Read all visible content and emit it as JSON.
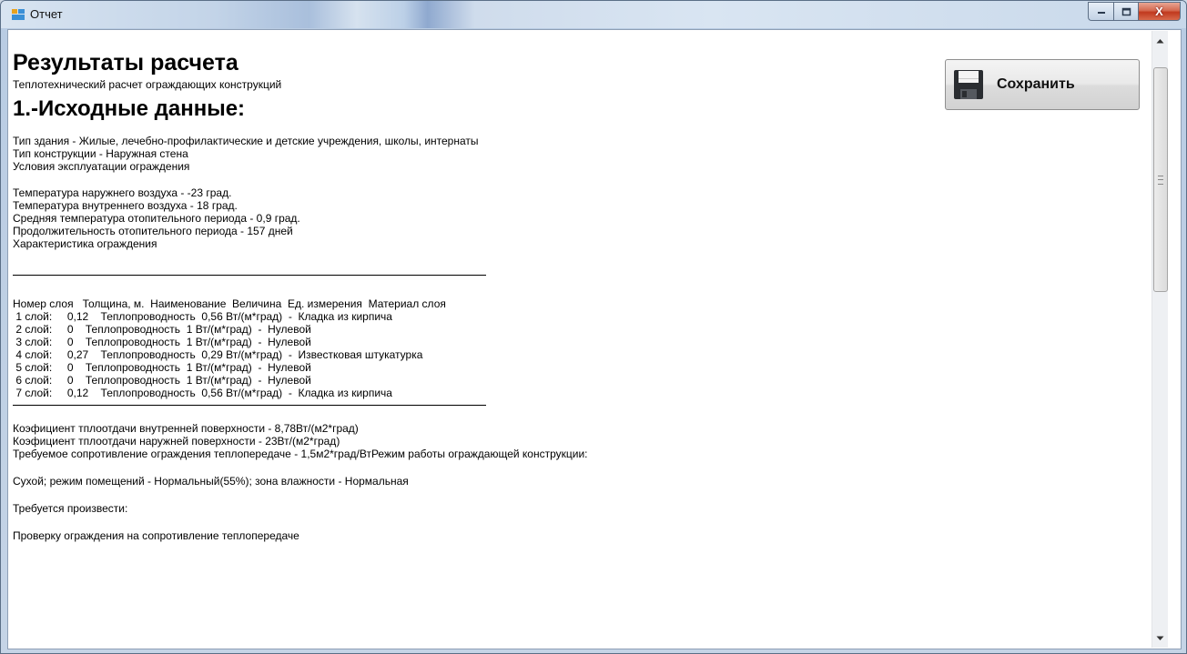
{
  "window": {
    "title": "Отчет",
    "close_glyph": "X"
  },
  "toolbar": {
    "save_label": "Сохранить",
    "save_icon": "floppy-disk-icon"
  },
  "report": {
    "heading": "Результаты расчета",
    "subtitle": "Теплотехнический расчет ограждающих конструкций",
    "section_title": "1.-Исходные данные:",
    "building": [
      "Тип здания - Жилые, лечебно-профилактические и детские учреждения, школы, интернаты",
      "Тип конструкции - Наружная стена",
      "Условия эксплуатации ограждения"
    ],
    "climate": [
      "Температура наружнего воздуха - -23 град.",
      "Температура внутреннего воздуха - 18 град.",
      "Средняя температура отопительного периода - 0,9 град.",
      "Продолжительность отопительного периода - 157 дней",
      "Характеристика ограждения"
    ],
    "layers_header": "Номер слоя   Толщина, м.  Наименование  Величина  Ед. измерения  Материал слоя",
    "layers": [
      " 1 слой:     0,12    Теплопроводность  0,56 Вт/(м*град)  -  Кладка из кирпича",
      " 2 слой:     0    Теплопроводность  1 Вт/(м*град)  -  Нулевой",
      " 3 слой:     0    Теплопроводность  1 Вт/(м*град)  -  Нулевой",
      " 4 слой:     0,27    Теплопроводность  0,29 Вт/(м*град)  -  Известковая штукатурка",
      " 5 слой:     0    Теплопроводность  1 Вт/(м*град)  -  Нулевой",
      " 6 слой:     0    Теплопроводность  1 Вт/(м*град)  -  Нулевой",
      " 7 слой:     0,12    Теплопроводность  0,56 Вт/(м*град)  -  Кладка из кирпича"
    ],
    "coefficients": [
      "Коэфициент тплоотдачи внутренней поверхности - 8,78Вт/(м2*град)",
      "Коэфициент тплоотдачи наружней поверхности - 23Вт/(м2*град)",
      "Требуемое сопротивление ограждения теплопередаче - 1,5м2*град/ВтРежим работы ограждающей конструкции:"
    ],
    "mode_line": "Сухой; режим помещений - Нормальный(55%); зона влажности - Нормальная",
    "required_line": "Требуется произвести:",
    "check_line": "Проверку ограждения на сопротивление теплопередаче"
  },
  "scrollbar": {
    "up_icon": "scroll-up-arrow-icon",
    "down_icon": "scroll-down-arrow-icon"
  }
}
